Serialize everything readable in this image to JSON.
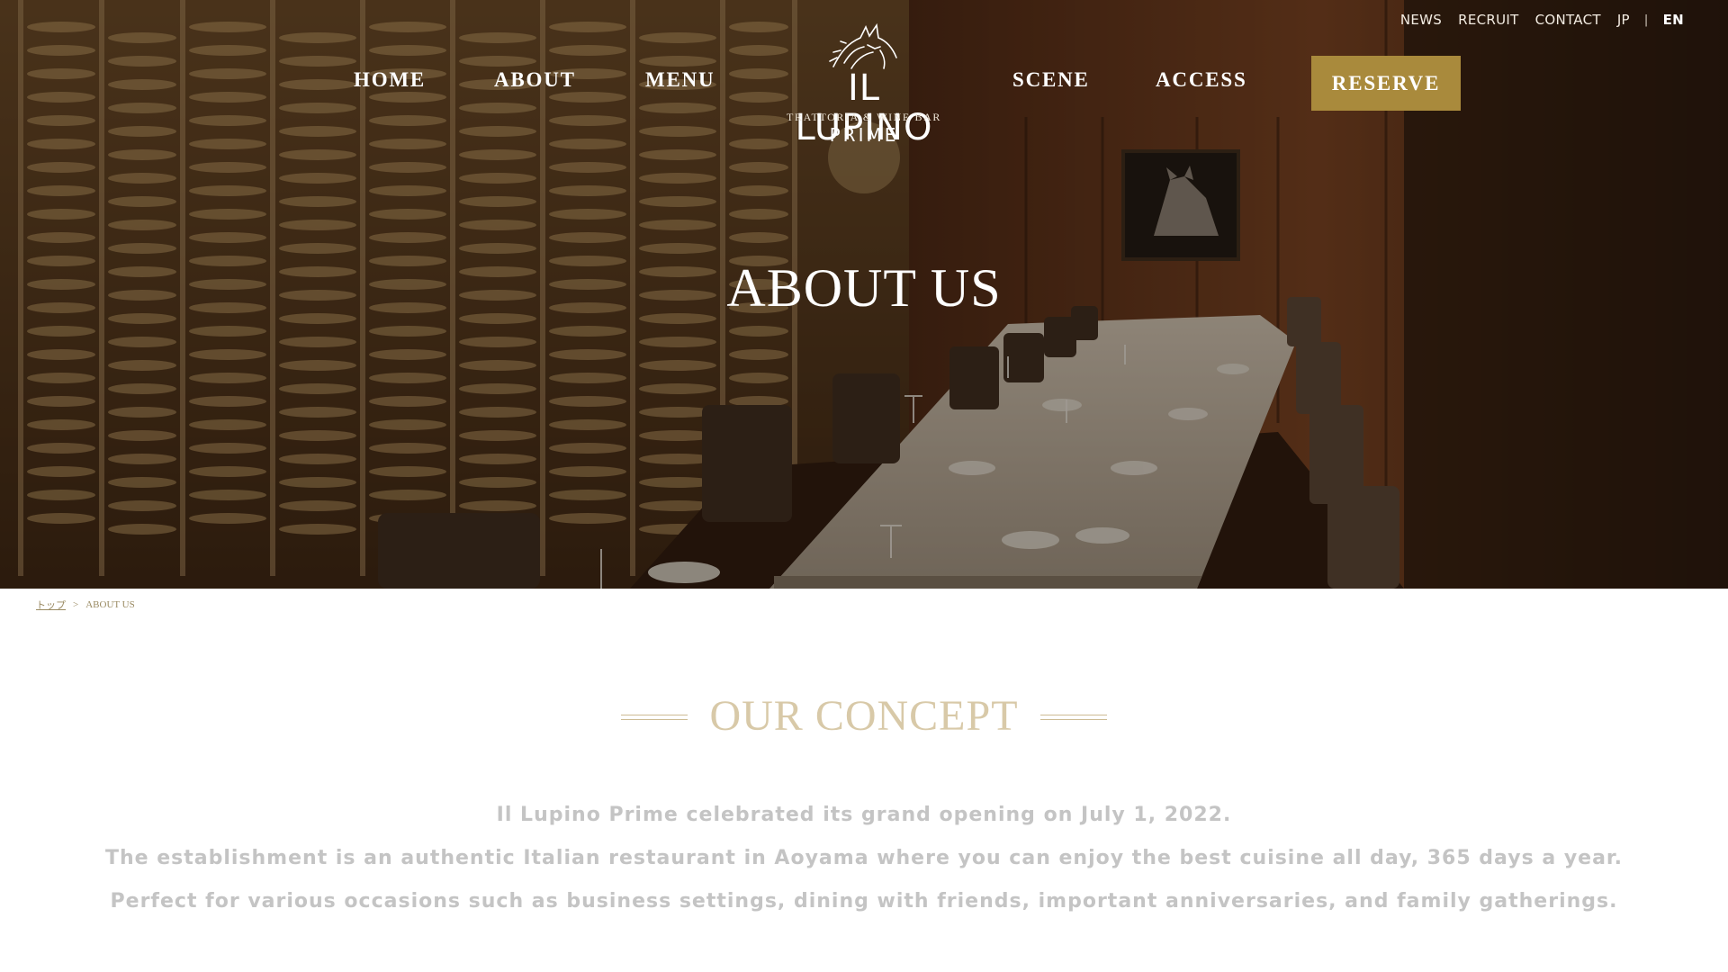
{
  "utility_nav": {
    "news": "NEWS",
    "recruit": "RECRUIT",
    "contact": "CONTACT",
    "jp": "JP",
    "separator": "|",
    "en": "EN"
  },
  "main_nav": {
    "home": "HOME",
    "about": "ABOUT",
    "menu": "MENU",
    "scene": "SCENE",
    "access": "ACCESS",
    "reserve": "RESERVE"
  },
  "logo": {
    "name": "IL LUPINO",
    "tagline": "TRATTORIA & WINE BAR",
    "sub": "PRIME"
  },
  "hero": {
    "title": "ABOUT US"
  },
  "breadcrumb": {
    "home": "トップ",
    "separator": ">",
    "current": "ABOUT US"
  },
  "concept": {
    "heading": "OUR CONCEPT",
    "lines": [
      "Il Lupino Prime celebrated its grand opening on July 1, 2022.",
      "The establishment is an authentic Italian restaurant in Aoyama where you can enjoy the best cuisine all day, 365 days a year.",
      "Perfect for various occasions such as business settings, dining with friends, important anniversaries, and family gatherings."
    ]
  },
  "colors": {
    "reserve_button": "#a98a3c",
    "concept_heading": "#d8c9a8",
    "concept_text": "#c4c4c4",
    "breadcrumb": "#9a8a62"
  }
}
